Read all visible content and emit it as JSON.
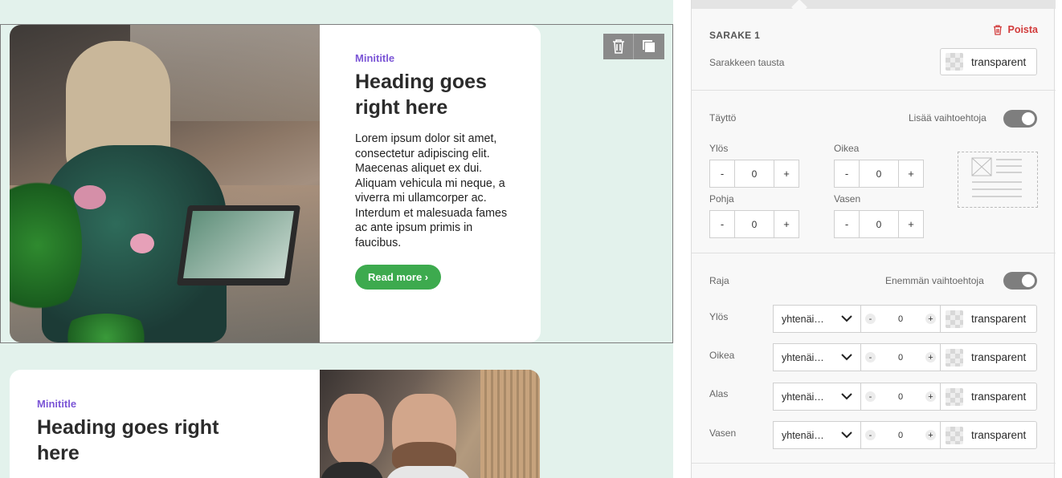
{
  "canvas": {
    "card1": {
      "minititle": "Minititle",
      "heading": "Heading goes right here",
      "body": "Lorem ipsum dolor sit amet, consectetur adipiscing elit. Maecenas aliquet ex dui. Aliquam vehicula mi neque, a viverra mi ullamcorper ac. Interdum et malesuada fames ac ante ipsum primis in faucibus.",
      "button": "Read more ›"
    },
    "card2": {
      "minititle": "Minititle",
      "heading": "Heading goes right here"
    },
    "toolbox": {
      "delete_icon": "trash-icon",
      "copy_icon": "copy-icon"
    }
  },
  "panel": {
    "column_title": "SARAKE 1",
    "delete_label": "Poista",
    "background_label": "Sarakkeen tausta",
    "background_value": "transparent",
    "padding": {
      "title": "Täyttö",
      "more_options": "Lisää vaihtoehtoja",
      "top_label": "Ylös",
      "top_value": "0",
      "right_label": "Oikea",
      "right_value": "0",
      "bottom_label": "Pohja",
      "bottom_value": "0",
      "left_label": "Vasen",
      "left_value": "0",
      "minus": "-",
      "plus": "+"
    },
    "border": {
      "title": "Raja",
      "more_options": "Enemmän vaihtoehtoja",
      "rows": [
        {
          "label": "Ylös",
          "style": "yhtenäi…",
          "value": "0",
          "color": "transparent"
        },
        {
          "label": "Oikea",
          "style": "yhtenäi…",
          "value": "0",
          "color": "transparent"
        },
        {
          "label": "Alas",
          "style": "yhtenäi…",
          "value": "0",
          "color": "transparent"
        },
        {
          "label": "Vasen",
          "style": "yhtenäi…",
          "value": "0",
          "color": "transparent"
        }
      ],
      "minus": "-",
      "plus": "+"
    }
  },
  "colors": {
    "accent_green": "#3daa4e",
    "minititle_purple": "#7b55d6",
    "delete_red": "#d23b3b",
    "canvas_bg": "#e3f2ec"
  }
}
